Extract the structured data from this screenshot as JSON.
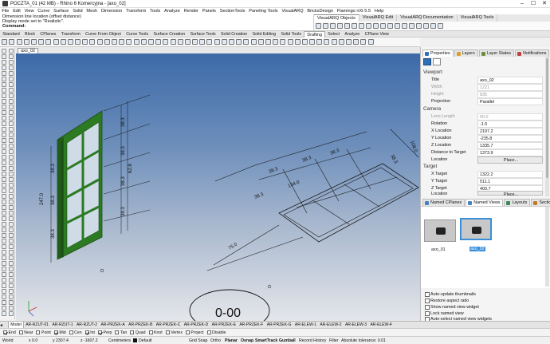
{
  "window": {
    "title": "POCZTA_01 (42 MB) - Rhino 6 Komercyjna - [axo_02]",
    "controls": [
      "–",
      "☐",
      "✕"
    ]
  },
  "menu": [
    "File",
    "Edit",
    "View",
    "Curve",
    "Surface",
    "Solid",
    "Mesh",
    "Dimension",
    "Transform",
    "Tools",
    "Analyze",
    "Render",
    "Panels",
    "SectionTools",
    "Paneling Tools",
    "VisualARQ",
    "BricksDesign",
    "Flamingo nXt 5.5",
    "Help"
  ],
  "command": {
    "history": [
      "Dimension line location (offset distance)",
      "Display mode set to \"Realistic\"."
    ],
    "prompt": "Command:"
  },
  "visualarq_tabs": [
    {
      "label": "VisualARQ Objects",
      "active": true
    },
    {
      "label": "VisualARQ Edit",
      "active": false
    },
    {
      "label": "VisualARQ Documentation",
      "active": false
    },
    {
      "label": "VisualARQ Tools",
      "active": false
    }
  ],
  "toolbar_tabs": [
    {
      "label": "Standard",
      "active": false
    },
    {
      "label": "Block",
      "active": false
    },
    {
      "label": "CPlanes",
      "active": false
    },
    {
      "label": "Transform",
      "active": false
    },
    {
      "label": "Curve From Object",
      "active": false
    },
    {
      "label": "Curve Tools",
      "active": false
    },
    {
      "label": "Surface Creation",
      "active": false
    },
    {
      "label": "Surface Tools",
      "active": false
    },
    {
      "label": "Solid Creation",
      "active": false
    },
    {
      "label": "Solid Editing",
      "active": false
    },
    {
      "label": "Solid Tools",
      "active": false
    },
    {
      "label": "Drafting",
      "active": true
    },
    {
      "label": "Select",
      "active": false
    },
    {
      "label": "Analyze",
      "active": false
    },
    {
      "label": "CPlane View",
      "active": false
    }
  ],
  "viewport": {
    "name": "axo_02",
    "dimensions": {
      "window_height": "247.0",
      "window_width": "38.3",
      "pane_1": "38.3",
      "pane_2": "38.3",
      "pane_3": "38.3",
      "right_1": "38.3",
      "right_2": "38.3",
      "right_3": "62.8",
      "right_4": "38.3",
      "right_5": "38.3",
      "plan_1": "38.3",
      "plan_2": "38.3",
      "plan_3": "134.0",
      "plan_4": "38.3",
      "plan_5": "38.3",
      "plan_6": "38.3",
      "plan_7": "75.0",
      "plan_8": "108.0",
      "bottom": "0-00"
    }
  },
  "panel": {
    "tabs": [
      {
        "label": "Properties",
        "active": true,
        "color": "#2e6fb8"
      },
      {
        "label": "Layers",
        "active": false,
        "color": "#d9a12a"
      },
      {
        "label": "Layer States",
        "active": false,
        "color": "#6b8e3a"
      },
      {
        "label": "Notifications",
        "active": false,
        "color": "#c04040"
      }
    ],
    "section_viewport": "Viewport",
    "viewport_props": [
      {
        "key": "Title",
        "value": "axo_02",
        "dim": false
      },
      {
        "key": "Width",
        "value": "1221",
        "dim": true
      },
      {
        "key": "Height",
        "value": "835",
        "dim": true
      },
      {
        "key": "Projection",
        "value": "Parallel",
        "dim": false
      }
    ],
    "section_camera": "Camera",
    "camera_props": [
      {
        "key": "Lens Length",
        "value": "50.0",
        "dim": true
      },
      {
        "key": "Rotation",
        "value": "-1.5",
        "dim": false
      },
      {
        "key": "X Location",
        "value": "2197.2",
        "dim": false
      },
      {
        "key": "Y Location",
        "value": "-235.8",
        "dim": false
      },
      {
        "key": "Z Location",
        "value": "1335.7",
        "dim": false
      },
      {
        "key": "Distance to Target",
        "value": "1373.9",
        "dim": false
      },
      {
        "key": "Location",
        "value": "Place...",
        "dim": false
      }
    ],
    "section_target": "Target",
    "target_props": [
      {
        "key": "X Target",
        "value": "1322.2",
        "dim": false
      },
      {
        "key": "Y Target",
        "value": "511.1",
        "dim": false
      },
      {
        "key": "Z Target",
        "value": "400.7",
        "dim": false
      },
      {
        "key": "Location",
        "value": "Place...",
        "dim": false
      }
    ],
    "lower_tabs": [
      {
        "label": "Named CPlanes",
        "active": false,
        "color": "#4a7fc0"
      },
      {
        "label": "Named Views",
        "active": true,
        "color": "#4a7fc0"
      },
      {
        "label": "Layouts",
        "active": false,
        "color": "#3b8a5a"
      },
      {
        "label": "Sections",
        "active": false,
        "color": "#c07a2a"
      }
    ],
    "named_views": [
      {
        "name": "axo_01",
        "selected": false
      },
      {
        "name": "axo_02",
        "selected": true
      }
    ],
    "options": [
      {
        "label": "Auto-update thumbnails",
        "checked": false
      },
      {
        "label": "Restore aspect ratio",
        "checked": false
      },
      {
        "label": "Show named view widget",
        "checked": false
      },
      {
        "label": "Lock named view",
        "checked": false
      },
      {
        "label": "Auto-select named view widgets",
        "checked": false
      }
    ]
  },
  "layout_tabs": [
    {
      "label": "Model",
      "active": true
    },
    {
      "label": "AR-RZUT-01",
      "active": false
    },
    {
      "label": "AR-RZUT-1",
      "active": false
    },
    {
      "label": "AR-RZUT-2",
      "active": false
    },
    {
      "label": "AR-PRZEK-A",
      "active": false
    },
    {
      "label": "AR-PRZEK-B",
      "active": false
    },
    {
      "label": "AR-PRZEK-C",
      "active": false
    },
    {
      "label": "AR-PRZEK-D",
      "active": false
    },
    {
      "label": "AR-PRZEK-E",
      "active": false
    },
    {
      "label": "AR-PRZEK-F",
      "active": false
    },
    {
      "label": "AR-PRZEK-G",
      "active": false
    },
    {
      "label": "AR-ELEW-1",
      "active": false
    },
    {
      "label": "AR-ELEW-2",
      "active": false
    },
    {
      "label": "AR-ELEW-3",
      "active": false
    },
    {
      "label": "AR-ELEW-4",
      "active": false
    }
  ],
  "osnaps": [
    {
      "label": "End",
      "checked": true
    },
    {
      "label": "Near",
      "checked": false
    },
    {
      "label": "Point",
      "checked": false
    },
    {
      "label": "Mid",
      "checked": true
    },
    {
      "label": "Cen",
      "checked": false
    },
    {
      "label": "Int",
      "checked": true
    },
    {
      "label": "Perp",
      "checked": true
    },
    {
      "label": "Tan",
      "checked": false
    },
    {
      "label": "Quad",
      "checked": false
    },
    {
      "label": "Knot",
      "checked": false
    },
    {
      "label": "Vertex",
      "checked": false
    },
    {
      "label": "Project",
      "checked": false
    },
    {
      "label": "Disable",
      "checked": false
    }
  ],
  "status": {
    "cplane": "World",
    "x": "x 0.0",
    "y": "y 2307.4",
    "z": "z -1607.2",
    "units": "Centimeters",
    "layer": "Default",
    "grid_snap": "Grid Snap",
    "ortho": "Ortho",
    "planar": "Planar",
    "osnap": "Osnap",
    "smarttrack": "SmartTrack",
    "gumball": "Gumball",
    "record_history": "Record History",
    "filter": "Filter",
    "tolerance": "Absolute tolerance: 0.01"
  }
}
